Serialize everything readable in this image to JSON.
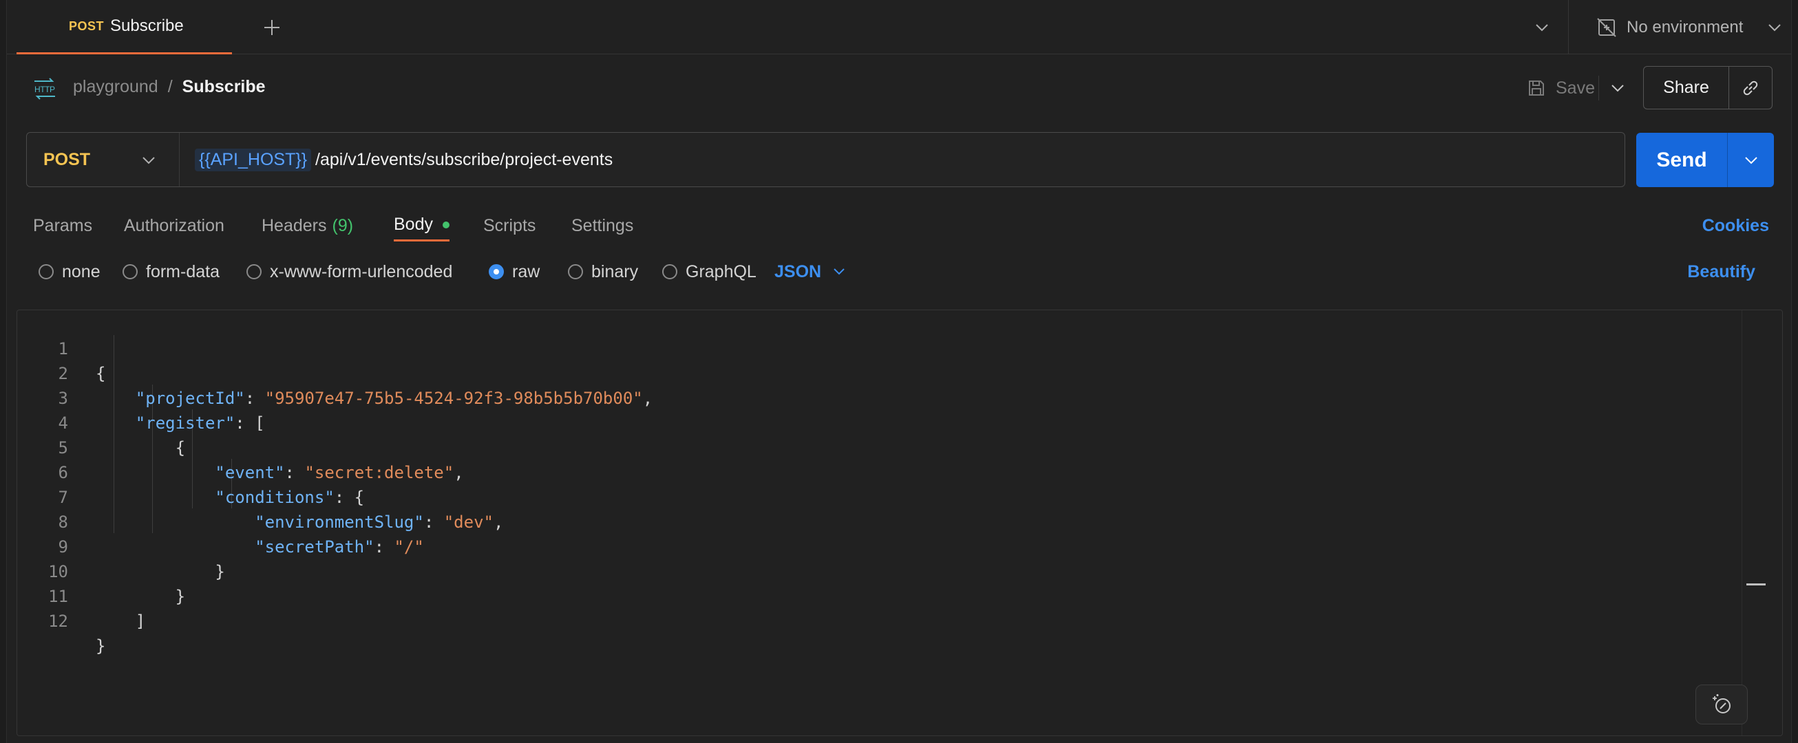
{
  "tabbar": {
    "active_tab": {
      "method": "POST",
      "name": "Subscribe"
    },
    "environment": "No environment"
  },
  "breadcrumb": {
    "parent": "playground",
    "separator": "/",
    "current": "Subscribe",
    "save_label": "Save",
    "share_label": "Share"
  },
  "request": {
    "method": "POST",
    "url_variable": "{{API_HOST}}",
    "url_path": "/api/v1/events/subscribe/project-events",
    "send_label": "Send"
  },
  "request_tabs": {
    "params": "Params",
    "authorization": "Authorization",
    "headers": "Headers",
    "headers_count": "(9)",
    "body": "Body",
    "scripts": "Scripts",
    "settings": "Settings",
    "cookies": "Cookies"
  },
  "body_types": {
    "none": "none",
    "form_data": "form-data",
    "urlencoded": "x-www-form-urlencoded",
    "raw": "raw",
    "binary": "binary",
    "graphql": "GraphQL",
    "selected": "raw",
    "format": "JSON",
    "beautify": "Beautify"
  },
  "editor": {
    "line_numbers": [
      "1",
      "2",
      "3",
      "4",
      "5",
      "6",
      "7",
      "8",
      "9",
      "10",
      "11",
      "12"
    ],
    "project_id_key": "\"projectId\"",
    "project_id_value": "\"95907e47-75b5-4524-92f3-98b5b5b70b00\"",
    "register_key": "\"register\"",
    "event_key": "\"event\"",
    "event_value": "\"secret:delete\"",
    "conditions_key": "\"conditions\"",
    "env_slug_key": "\"environmentSlug\"",
    "env_slug_value": "\"dev\"",
    "secret_path_key": "\"secretPath\"",
    "secret_path_value": "\"/\""
  },
  "colors": {
    "accent_tab": "#f26b3a",
    "method_post": "#f5c452",
    "primary": "#1668dc",
    "link": "#3d8ff0",
    "success": "#43c26c",
    "json_key": "#6fb3f5",
    "json_string": "#e08b5b"
  },
  "icons": [
    "plus-icon",
    "chevron-down-icon",
    "no-environment-icon",
    "http-icon",
    "save-icon",
    "link-icon",
    "assistant-icon"
  ]
}
